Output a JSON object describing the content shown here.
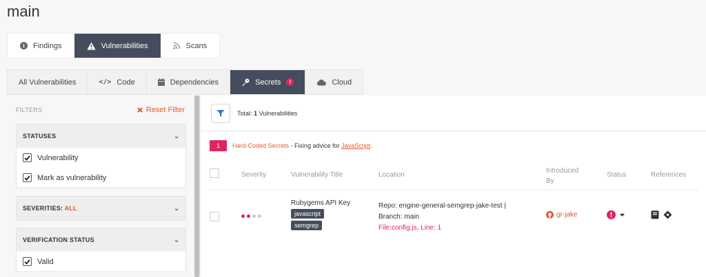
{
  "page": {
    "title": "main"
  },
  "tabs": [
    {
      "label": "Findings",
      "icon": "info-circle-icon",
      "active": false
    },
    {
      "label": "Vulnerabilities",
      "icon": "warning-icon",
      "active": true
    },
    {
      "label": "Scans",
      "icon": "rss-icon",
      "active": false
    }
  ],
  "subtabs": [
    {
      "label": "All Vulnerabilities",
      "icon": "",
      "active": false
    },
    {
      "label": "Code",
      "icon": "code-icon",
      "active": false
    },
    {
      "label": "Dependencies",
      "icon": "calendar-icon",
      "active": false
    },
    {
      "label": "Secrets",
      "icon": "key-icon",
      "active": true,
      "badge": "!"
    },
    {
      "label": "Cloud",
      "icon": "cloud-icon",
      "active": false
    }
  ],
  "filters": {
    "label": "FILTERS",
    "reset_label": "Reset Filter",
    "statuses": {
      "title": "STATUSES",
      "options": [
        {
          "label": "Vulnerability",
          "checked": true
        },
        {
          "label": "Mark as vulnerability",
          "checked": true
        }
      ]
    },
    "severities": {
      "title": "SEVERITIES:",
      "value": "ALL"
    },
    "verification": {
      "title": "VERIFICATION STATUS",
      "options": [
        {
          "label": "Valid",
          "checked": true
        }
      ]
    }
  },
  "results": {
    "total_prefix": "Total:",
    "total_count": "1",
    "total_suffix": "Vulnerabilities",
    "advice": {
      "count": "1",
      "title": "Hard-Coded Secrets",
      "text": " - Fixing advice for ",
      "link": "JavaScript",
      "end": "."
    },
    "columns": {
      "severity": "Severity",
      "title": "Vulnerability Title",
      "location": "Location",
      "introduced_line1": "Introduced",
      "introduced_line2": "By",
      "status": "Status",
      "references": "References"
    },
    "rows": [
      {
        "title": "Rubygems API Key",
        "tags": [
          "javascript",
          "semgrep"
        ],
        "severity_level": 2,
        "severity_max": 4,
        "location_repo": "Repo: engine-general-semgrep-jake-test |",
        "location_branch": "Branch: main",
        "location_file": "File:config.js, Line: 1",
        "introduced_by": "gr-jake"
      }
    ]
  },
  "colors": {
    "accent": "#e25a2a",
    "danger": "#e0245e",
    "active_tab": "#454d5d"
  }
}
